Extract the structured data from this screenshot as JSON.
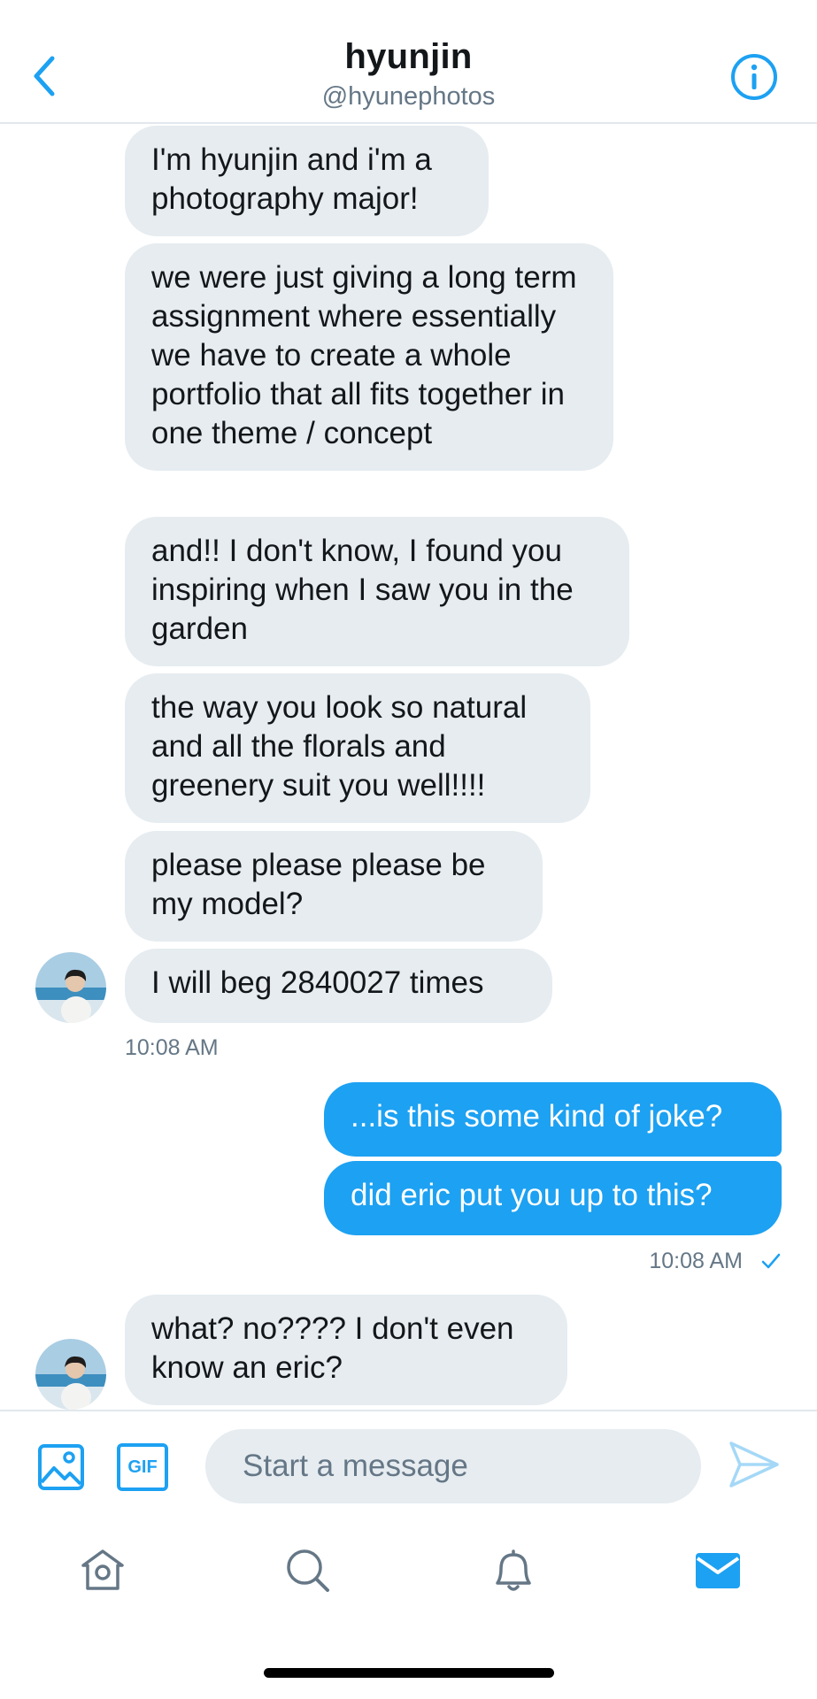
{
  "header": {
    "title": "hyunjin",
    "handle": "@hyunephotos"
  },
  "colors": {
    "accent": "#1da1f2",
    "received_bubble": "#e6ecf0",
    "secondary_text": "#657786"
  },
  "messages": {
    "m1": "I'm hyunjin and i'm a photography major!",
    "m2": "we were just giving a long term assignment where essentially we have to create a whole portfolio that all fits together in one theme / concept",
    "m3": "and!! I don't know, I found you inspiring when I saw you in the garden",
    "m4": "the way you look so natural and all the florals and greenery suit you well!!!!",
    "m5": "please please please be my model?",
    "m6": "I will beg 2840027 times",
    "t1": "10:08 AM",
    "s1": "...is this some kind of joke?",
    "s2": "did eric put you up to this?",
    "t2": "10:08 AM",
    "m7": "what? no???? I don't even know an eric?"
  },
  "composer": {
    "gif_label": "GIF",
    "placeholder": "Start a message"
  },
  "icons": {
    "back": "chevron-left-icon",
    "info": "info-icon",
    "image": "image-icon",
    "send": "send-icon",
    "home": "home-icon",
    "search": "search-icon",
    "notifications": "bell-icon",
    "messages": "mail-icon"
  }
}
